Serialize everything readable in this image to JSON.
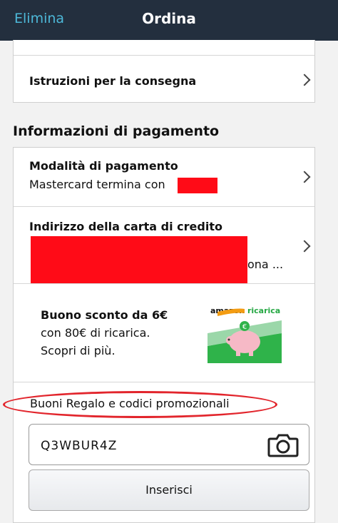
{
  "nav": {
    "left_action": "Elimina",
    "title": "Ordina"
  },
  "delivery": {
    "instructions_label": "Istruzioni per la consegna"
  },
  "payment": {
    "section_title": "Informazioni di pagamento",
    "method": {
      "title": "Modalità di pagamento",
      "value": "Mastercard termina con"
    },
    "billing_address": {
      "title": "Indirizzo della carta di credito",
      "visible_fragment": "ona ..."
    }
  },
  "promo_banner": {
    "headline": "Buono sconto da 6€",
    "line2": "con 80€ di ricarica.",
    "line3": "Scopri di più.",
    "logo_text_1": "amazon",
    "logo_text_2": "ricarica"
  },
  "gift": {
    "label": "Buoni Regalo e codici promozionali",
    "code_value": "Q3WBUR4Z",
    "submit_label": "Inserisci"
  },
  "colors": {
    "nav_bg": "#232f3e",
    "nav_link": "#4db8d8",
    "redaction": "#ff0b17",
    "highlight_oval": "#e2252c"
  }
}
